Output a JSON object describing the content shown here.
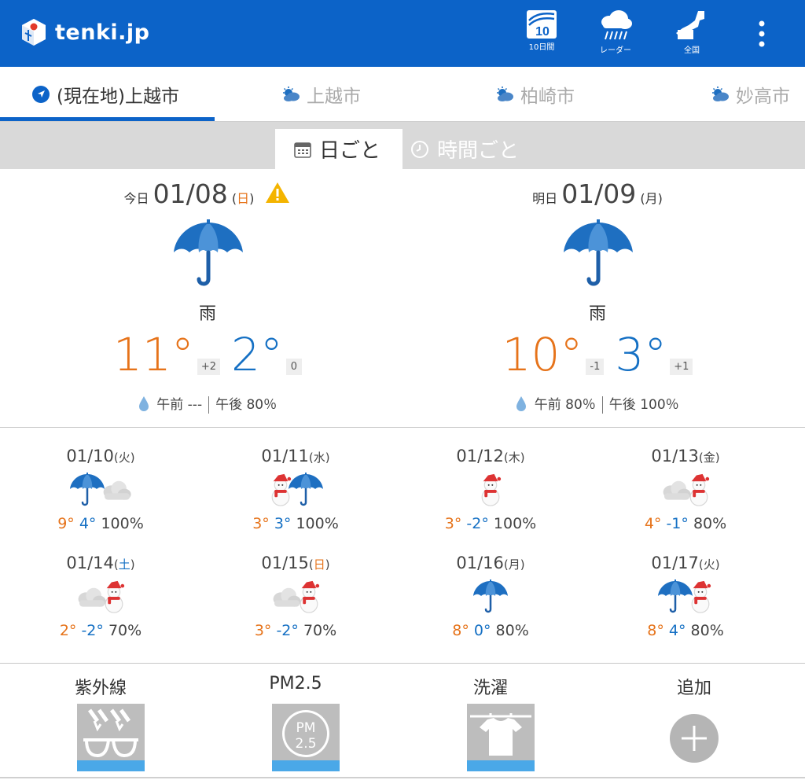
{
  "app": {
    "logo_text": "tenki.jp"
  },
  "header_buttons": [
    {
      "label": "10日間",
      "icon": "ten-day-icon",
      "number": "10"
    },
    {
      "label": "レーダー",
      "icon": "radar-icon"
    },
    {
      "label": "全国",
      "icon": "japan-map-icon"
    }
  ],
  "locations": [
    {
      "label": "(現在地)上越市",
      "active": true
    },
    {
      "label": "上越市"
    },
    {
      "label": "柏崎市"
    },
    {
      "label": "妙高市"
    }
  ],
  "view_tabs": {
    "daily": "日ごと",
    "hourly": "時間ごと"
  },
  "today": {
    "label": "今日",
    "date": "01/08",
    "weekday": "日",
    "weather": "雨",
    "high": "11°",
    "high_diff": "+2",
    "low": "2°",
    "low_diff": "0",
    "precip_am": "午前 ---",
    "precip_pm": "午後 80％",
    "warning": true
  },
  "tomorrow": {
    "label": "明日",
    "date": "01/09",
    "weekday": "月",
    "weather": "雨",
    "high": "10°",
    "high_diff": "-1",
    "low": "3°",
    "low_diff": "+1",
    "precip_am": "午前 80％",
    "precip_pm": "午後 100％"
  },
  "weekly": [
    {
      "date": "01/10",
      "weekday": "火",
      "high": "9°",
      "low": "4°",
      "pop": "100%",
      "icons": [
        "umbrella",
        "cloud"
      ]
    },
    {
      "date": "01/11",
      "weekday": "水",
      "high": "3°",
      "low": "3°",
      "pop": "100%",
      "icons": [
        "snowman",
        "umbrella"
      ]
    },
    {
      "date": "01/12",
      "weekday": "木",
      "high": "3°",
      "low": "-2°",
      "pop": "100%",
      "icons": [
        "snowman"
      ]
    },
    {
      "date": "01/13",
      "weekday": "金",
      "high": "4°",
      "low": "-1°",
      "pop": "80%",
      "icons": [
        "cloud",
        "snowman"
      ]
    },
    {
      "date": "01/14",
      "weekday": "土",
      "high": "2°",
      "low": "-2°",
      "pop": "70%",
      "icons": [
        "cloud",
        "snowman"
      ]
    },
    {
      "date": "01/15",
      "weekday": "日",
      "high": "3°",
      "low": "-2°",
      "pop": "70%",
      "icons": [
        "cloud",
        "snowman"
      ]
    },
    {
      "date": "01/16",
      "weekday": "月",
      "high": "8°",
      "low": "0°",
      "pop": "80%",
      "icons": [
        "umbrella"
      ]
    },
    {
      "date": "01/17",
      "weekday": "火",
      "high": "8°",
      "low": "4°",
      "pop": "80%",
      "icons": [
        "umbrella",
        "snowman"
      ]
    }
  ],
  "indices": [
    {
      "label": "紫外線",
      "icon": "uv-sunglasses-icon"
    },
    {
      "label": "PM2.5",
      "icon": "pm25-icon",
      "badge_top": "PM",
      "badge_bottom": "2.5"
    },
    {
      "label": "洗濯",
      "icon": "laundry-icon"
    },
    {
      "label": "追加",
      "icon": "add-icon"
    }
  ],
  "colors": {
    "brand": "#0c63c8",
    "high": "#e6731a",
    "low": "#1570c4",
    "umbrella": "#1e6fc1"
  }
}
